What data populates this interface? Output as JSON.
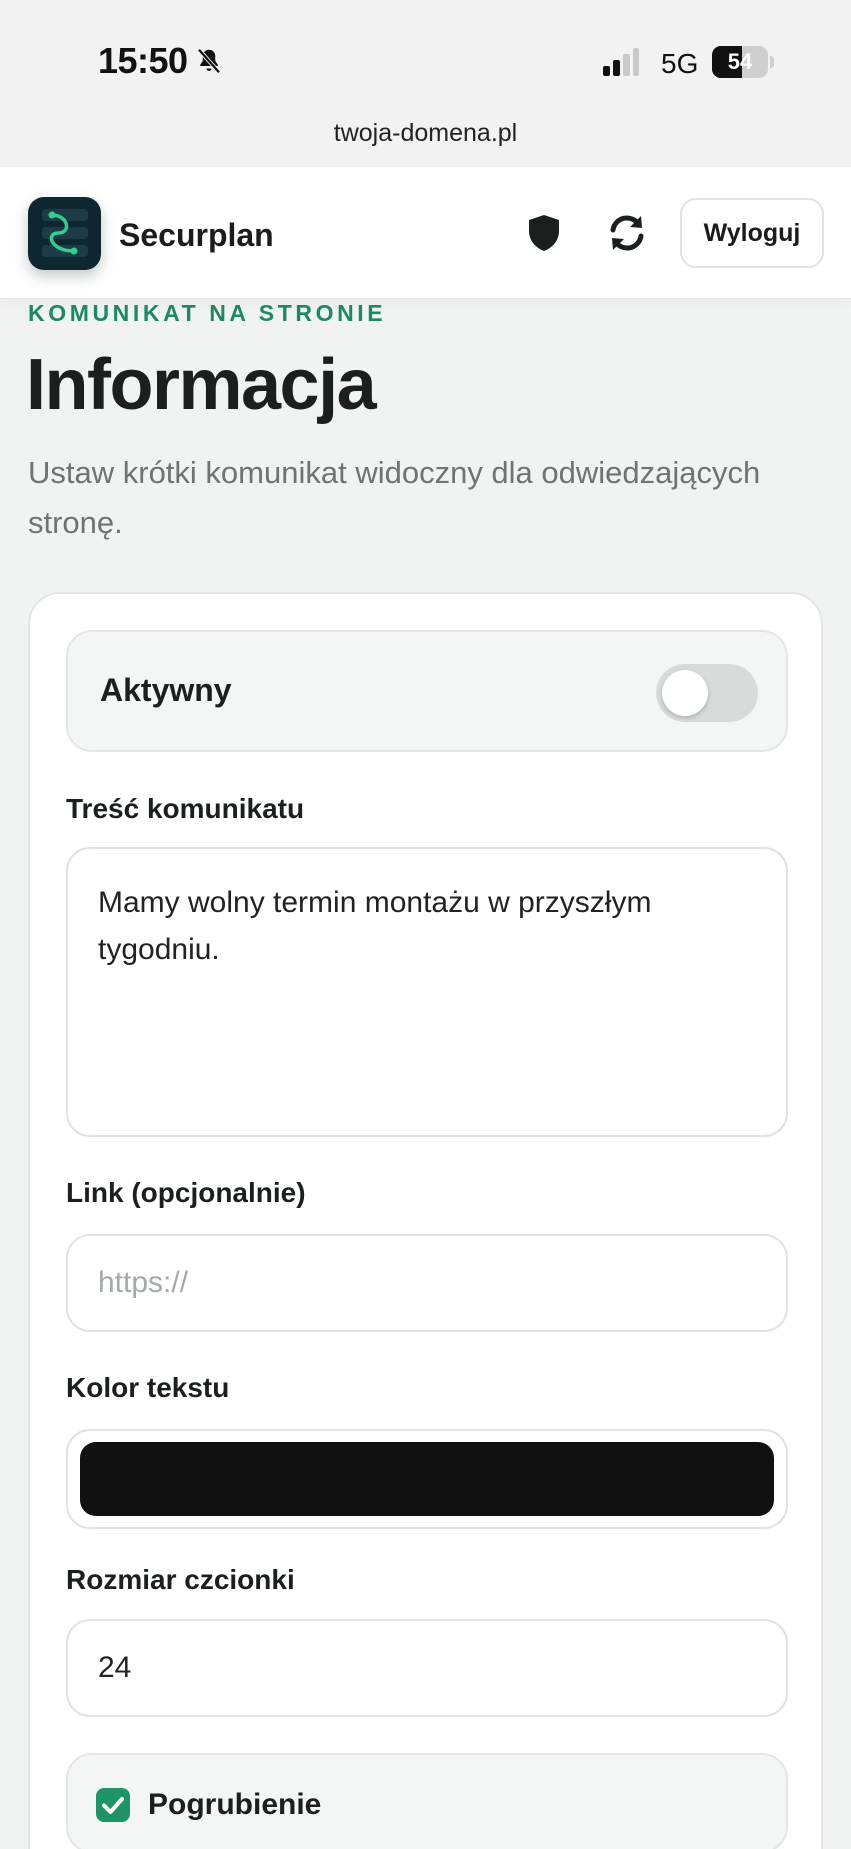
{
  "status_bar": {
    "time": "15:50",
    "network": "5G",
    "battery": "54",
    "battery_level": 0.54
  },
  "browser": {
    "url": "twoja-domena.pl"
  },
  "header": {
    "brand": "Securplan",
    "logout_label": "Wyloguj"
  },
  "page": {
    "eyebrow": "KOMUNIKAT NA STRONIE",
    "title": "Informacja",
    "description": "Ustaw krótki komunikat widoczny dla odwiedzających stronę."
  },
  "form": {
    "active_label": "Aktywny",
    "active_on": false,
    "message_label": "Treść komunikatu",
    "message_value": "Mamy wolny termin montażu w przyszłym tygodniu.",
    "link_label": "Link (opcjonalnie)",
    "link_placeholder": "https://",
    "link_value": "",
    "color_label": "Kolor tekstu",
    "color_value": "#111111",
    "size_label": "Rozmiar czcionki",
    "size_value": "24",
    "bold_label": "Pogrubienie",
    "bold_checked": true
  },
  "colors": {
    "accent": "#1c8a5e",
    "checkbox": "#1f9466",
    "logo_bg": "#0f2730"
  }
}
